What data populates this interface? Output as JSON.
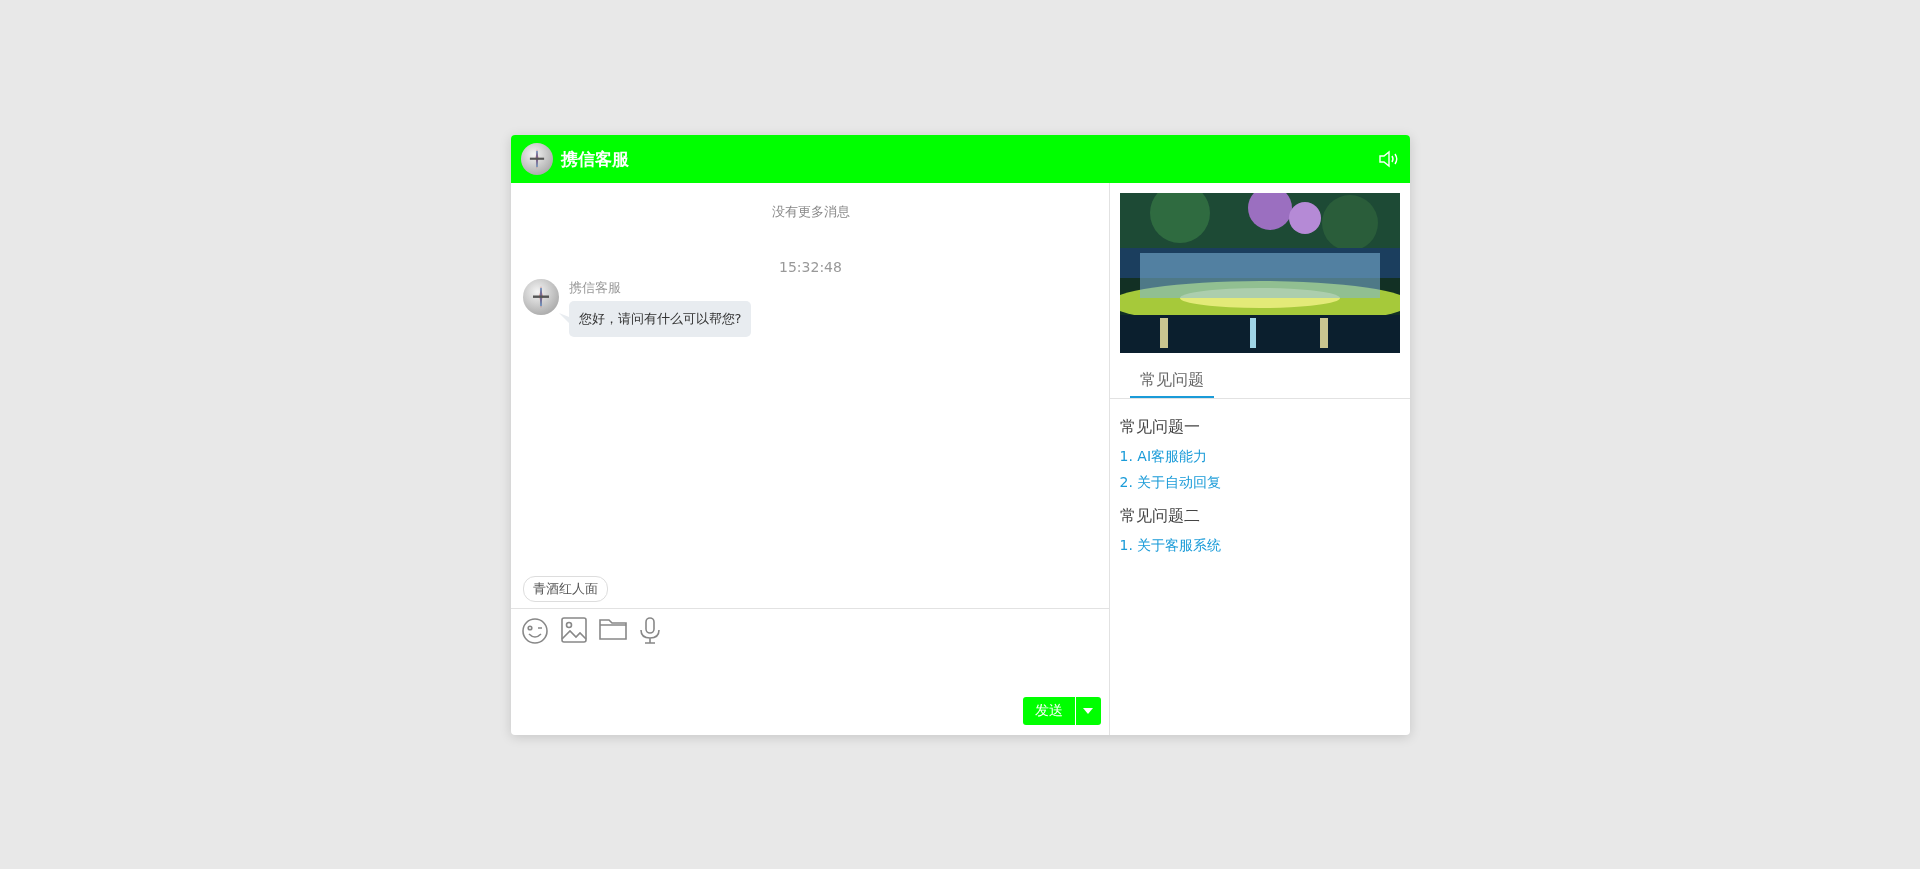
{
  "header": {
    "title": "携信客服"
  },
  "chat": {
    "notice": "没有更多消息",
    "messages": [
      {
        "time": "15:32:48",
        "sender": "携信客服",
        "text": "您好，请问有什么可以帮您?"
      }
    ],
    "quick_replies": [
      "青酒红人面"
    ],
    "send_button": "发送"
  },
  "side": {
    "tabs": [
      {
        "label": "常见问题",
        "selected": true
      }
    ],
    "groups": [
      {
        "title": "常见问题一",
        "items": [
          "1. AI客服能力",
          "2. 关于自动回复"
        ]
      },
      {
        "title": "常见问题二",
        "items": [
          "1. 关于客服系统"
        ]
      }
    ]
  }
}
